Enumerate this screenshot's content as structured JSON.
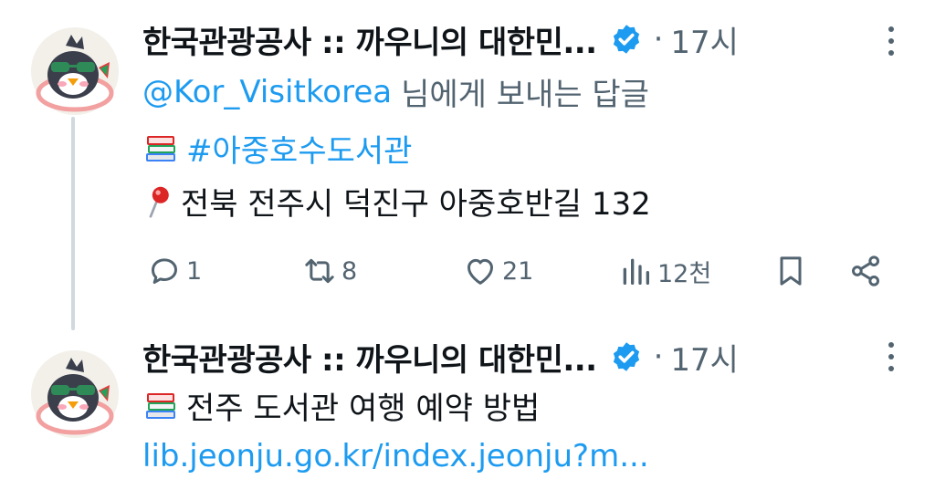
{
  "tweets": [
    {
      "author": "한국관광공사 :: 까우니의 대한민...",
      "separator": "·",
      "time": "17시",
      "reply_to": {
        "handle": "@Kor_Visitkorea",
        "suffix": "님에게 보내는 답글"
      },
      "hashtag": "#아중호수도서관",
      "address": "전북 전주시 덕진구 아중호반길 132",
      "stats": {
        "replies": "1",
        "retweets": "8",
        "likes": "21",
        "views": "12천"
      }
    },
    {
      "author": "한국관광공사 :: 까우니의 대한민...",
      "separator": "·",
      "time": "17시",
      "title": "전주 도서관 여행 예약 방법",
      "link": "lib.jeonju.go.kr/index.jeonju?m..."
    }
  ],
  "icons": {
    "verified": "verified-badge-icon",
    "more": "more-vertical-icon",
    "books": "books-emoji",
    "pin": "round-pushpin-emoji",
    "reply": "reply-icon",
    "retweet": "retweet-icon",
    "like": "heart-icon",
    "views": "views-icon",
    "bookmark": "bookmark-icon",
    "share": "share-icon"
  },
  "colors": {
    "accent": "#1d9bf0",
    "muted": "#536471",
    "thread_line": "#cfd9de"
  }
}
